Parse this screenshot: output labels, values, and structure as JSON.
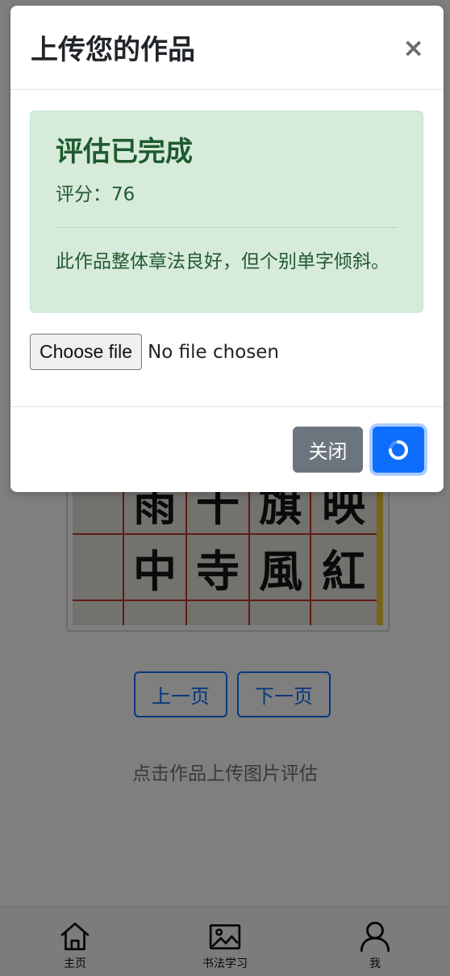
{
  "modal": {
    "title": "上传您的作品",
    "close_symbol": "×",
    "alert": {
      "heading": "评估已完成",
      "score_text": "评分：76",
      "comment": "此作品整体章法良好，但个别单字倾斜。"
    },
    "file_input": {
      "button_label": "Choose file",
      "status": "No file chosen"
    },
    "footer": {
      "close_label": "关闭",
      "submit_icon": "spinner-icon"
    }
  },
  "background": {
    "artwork_chars": [
      "雨",
      "十",
      "旗",
      "映",
      "中",
      "寺",
      "風",
      "紅"
    ],
    "prev_label": "上一页",
    "next_label": "下一页",
    "hint": "点击作品上传图片评估"
  },
  "bottom_nav": [
    {
      "label": "主页",
      "icon": "home-icon"
    },
    {
      "label": "书法学习",
      "icon": "image-icon"
    },
    {
      "label": "我",
      "icon": "user-icon"
    }
  ],
  "colors": {
    "primary": "#0d6efd",
    "secondary": "#6c757d",
    "success_bg": "#d7ebdb",
    "success_text": "#245a32"
  }
}
